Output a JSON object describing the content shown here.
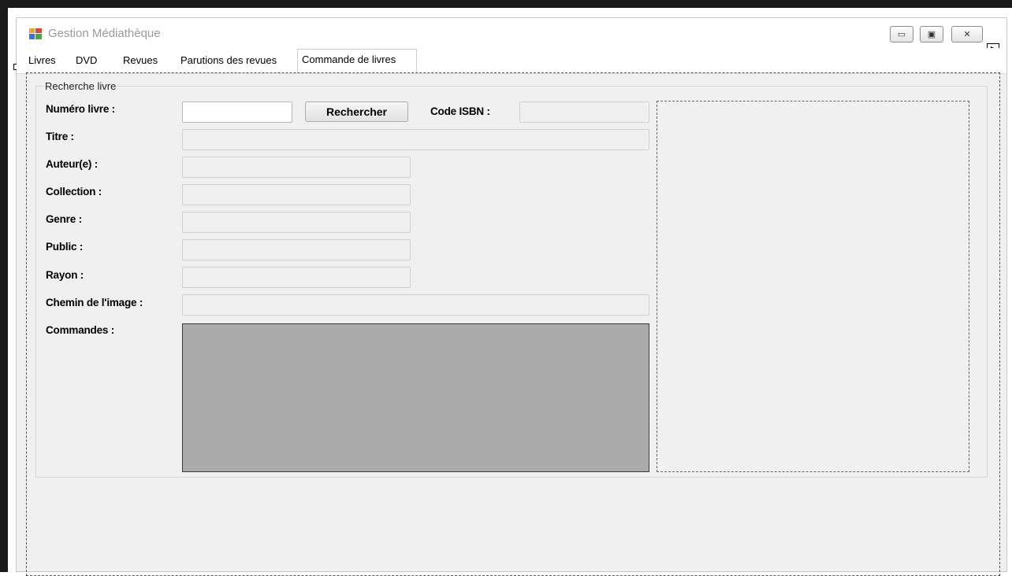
{
  "window": {
    "title": "Gestion Médiathèque",
    "icon": "windows-form-icon",
    "controls": {
      "minimize": "▭",
      "maximize": "▣",
      "close": "✕"
    }
  },
  "tabs": [
    {
      "label": "Livres"
    },
    {
      "label": "DVD"
    },
    {
      "label": "Revues"
    },
    {
      "label": "Parutions des revues"
    },
    {
      "label": "Commande de livres",
      "active": true
    }
  ],
  "group": {
    "title": "Recherche livre",
    "labels": {
      "numero": "Numéro livre :",
      "isbn": "Code ISBN :",
      "titre": "Titre :",
      "auteur": "Auteur(e) :",
      "collection": "Collection :",
      "genre": "Genre :",
      "public": "Public :",
      "rayon": "Rayon :",
      "chemin": "Chemin de l'image :",
      "commandes": "Commandes :"
    },
    "search_button": "Rechercher",
    "values": {
      "numero": "",
      "isbn": "",
      "titre": "",
      "auteur": "",
      "collection": "",
      "genre": "",
      "public": "",
      "rayon": "",
      "chemin": ""
    }
  },
  "colors": {
    "grid": "#ababab",
    "form_bg": "#f0f0f0"
  }
}
